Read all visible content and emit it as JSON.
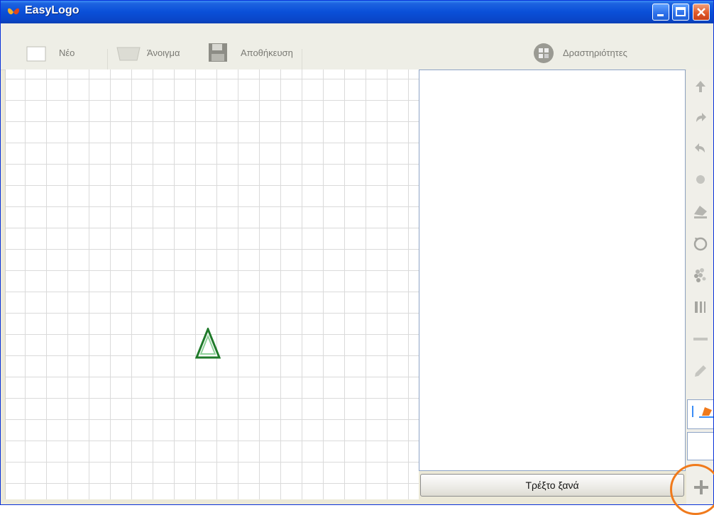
{
  "window": {
    "title": "EasyLogo"
  },
  "toolbar": {
    "new_label": "Νέο",
    "open_label": "Άνοιγμα",
    "save_label": "Αποθήκευση",
    "activities_label": "Δραστηριότητες"
  },
  "code_panel": {
    "run_again_label": "Τρέξτο ξανά"
  },
  "side_commands": [
    "forward-arrow-icon",
    "turn-right-icon",
    "turn-left-icon",
    "dot-icon",
    "pen-up-icon",
    "rotate-icon",
    "repeat-icon",
    "pen-width-icon",
    "line-icon",
    "pen-color-icon",
    "flag-icon",
    "plus-icon"
  ],
  "colors": {
    "titlebar": "#0a4fd8",
    "highlight": "#f07a1c",
    "turtle": "#1f7a2a"
  }
}
